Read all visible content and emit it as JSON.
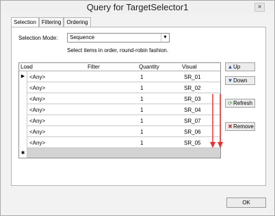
{
  "window": {
    "title": "Query for TargetSelector1",
    "close_glyph": "×"
  },
  "tabs": [
    {
      "label": "Selection",
      "active": true
    },
    {
      "label": "Filtering",
      "active": false
    },
    {
      "label": "Ordering",
      "active": false
    }
  ],
  "selection": {
    "mode_label": "Selection Mode:",
    "mode_value": "Sequence",
    "mode_description": "Select items in order, round-robin fashion."
  },
  "grid": {
    "columns": [
      "Load",
      "Filter",
      "Quantity",
      "Visual"
    ],
    "rows": [
      {
        "load": "<Any>",
        "filter": "",
        "quantity": "1",
        "visual": "SR_01",
        "current": true
      },
      {
        "load": "<Any>",
        "filter": "",
        "quantity": "1",
        "visual": "SR_02",
        "current": false
      },
      {
        "load": "<Any>",
        "filter": "",
        "quantity": "1",
        "visual": "SR_03",
        "current": false
      },
      {
        "load": "<Any>",
        "filter": "",
        "quantity": "1",
        "visual": "SR_04",
        "current": false
      },
      {
        "load": "<Any>",
        "filter": "",
        "quantity": "1",
        "visual": "SR_07",
        "current": false
      },
      {
        "load": "<Any>",
        "filter": "",
        "quantity": "1",
        "visual": "SR_06",
        "current": false
      },
      {
        "load": "<Any>",
        "filter": "",
        "quantity": "1",
        "visual": "SR_05",
        "current": false
      }
    ],
    "current_row_glyph": "▶",
    "new_row_glyph": "✱"
  },
  "buttons": {
    "up": {
      "label": "Up",
      "icon": "up-arrow-icon"
    },
    "down": {
      "label": "Down",
      "icon": "down-arrow-icon"
    },
    "refresh": {
      "label": "Refresh",
      "icon": "refresh-icon"
    },
    "remove": {
      "label": "Remove",
      "icon": "remove-icon"
    },
    "ok": "OK"
  },
  "colors": {
    "annotation": "#e8312e",
    "grid_empty": "#a9a9a9",
    "new_row": "#d3d3d3",
    "icon_blue": "#2e56a8"
  }
}
